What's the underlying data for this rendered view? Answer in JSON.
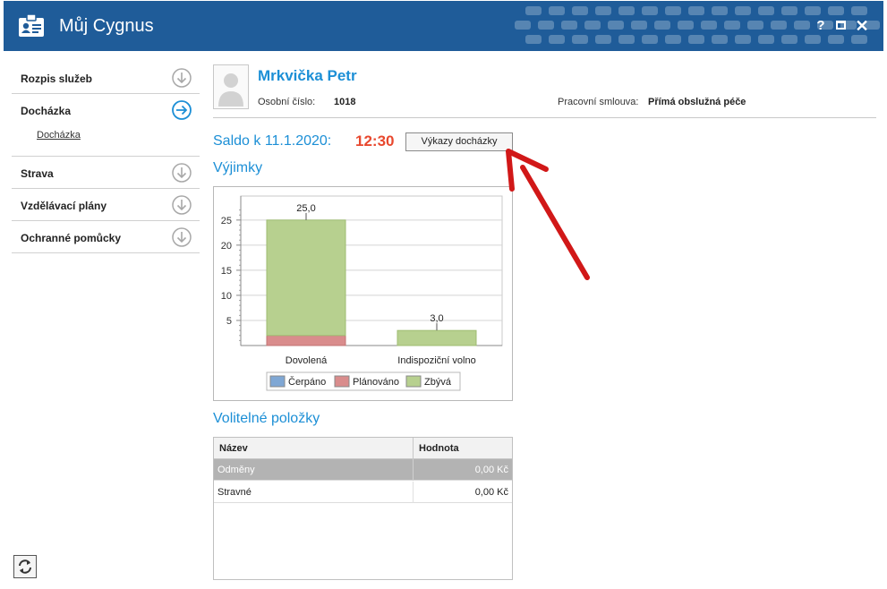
{
  "window": {
    "title": "Můj Cygnus",
    "help_label": "?",
    "close_label": "✕",
    "accent_color": "#1f5c99"
  },
  "sidebar": {
    "items": [
      {
        "label": "Rozpis služeb",
        "icon": "chevron-down-circle-icon",
        "active": false
      },
      {
        "label": "Docházka",
        "icon": "arrow-right-circle-icon",
        "active": true,
        "sub": "Docházka"
      },
      {
        "label": "Strava",
        "icon": "chevron-down-circle-icon",
        "active": false
      },
      {
        "label": "Vzdělávací plány",
        "icon": "chevron-down-circle-icon",
        "active": false
      },
      {
        "label": "Ochranné pomůcky",
        "icon": "chevron-down-circle-icon",
        "active": false
      }
    ]
  },
  "profile": {
    "name": "Mrkvička Petr",
    "personal_number_label": "Osobní číslo:",
    "personal_number": "1018",
    "contract_label": "Pracovní smlouva:",
    "contract": "Přímá obslužná péče"
  },
  "saldo": {
    "label": "Saldo k 11.1.2020:",
    "value": "12:30",
    "button_label": "Výkazy docházky"
  },
  "exceptions": {
    "title": "Výjimky"
  },
  "chart_data": {
    "type": "bar",
    "stacked": true,
    "categories": [
      "Dovolená",
      "Indispoziční volno"
    ],
    "series": [
      {
        "name": "Čerpáno",
        "values": [
          0,
          0
        ],
        "color": "#7fa7d4"
      },
      {
        "name": "Plánováno",
        "values": [
          2,
          0
        ],
        "color": "#d98c8c"
      },
      {
        "name": "Zbývá",
        "values": [
          23,
          3
        ],
        "color": "#b7d08f"
      }
    ],
    "totals_labels": [
      "25,0",
      "3,0"
    ],
    "totals": [
      25,
      3
    ],
    "y_ticks": [
      "5",
      "10",
      "15",
      "20",
      "25"
    ],
    "ylim": [
      0,
      28
    ],
    "legend_position": "bottom",
    "grid": true
  },
  "optional_items": {
    "title": "Volitelné položky",
    "columns": [
      "Název",
      "Hodnota"
    ],
    "rows": [
      {
        "name": "Odměny",
        "value": "0,00 Kč",
        "selected": true
      },
      {
        "name": "Stravné",
        "value": "0,00 Kč",
        "selected": false
      }
    ]
  }
}
